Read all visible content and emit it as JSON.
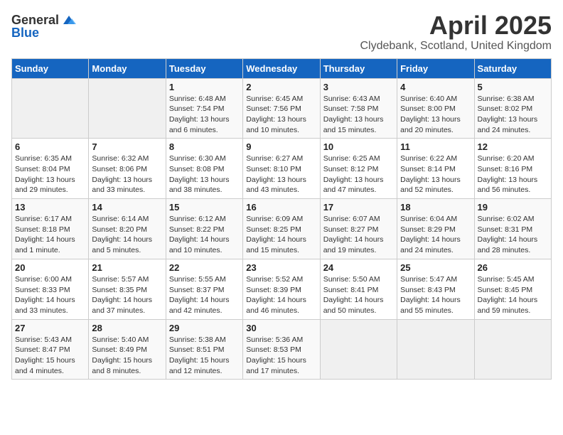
{
  "header": {
    "logo_general": "General",
    "logo_blue": "Blue",
    "month_year": "April 2025",
    "location": "Clydebank, Scotland, United Kingdom"
  },
  "weekdays": [
    "Sunday",
    "Monday",
    "Tuesday",
    "Wednesday",
    "Thursday",
    "Friday",
    "Saturday"
  ],
  "weeks": [
    [
      {
        "day": "",
        "info": ""
      },
      {
        "day": "",
        "info": ""
      },
      {
        "day": "1",
        "info": "Sunrise: 6:48 AM\nSunset: 7:54 PM\nDaylight: 13 hours\nand 6 minutes."
      },
      {
        "day": "2",
        "info": "Sunrise: 6:45 AM\nSunset: 7:56 PM\nDaylight: 13 hours\nand 10 minutes."
      },
      {
        "day": "3",
        "info": "Sunrise: 6:43 AM\nSunset: 7:58 PM\nDaylight: 13 hours\nand 15 minutes."
      },
      {
        "day": "4",
        "info": "Sunrise: 6:40 AM\nSunset: 8:00 PM\nDaylight: 13 hours\nand 20 minutes."
      },
      {
        "day": "5",
        "info": "Sunrise: 6:38 AM\nSunset: 8:02 PM\nDaylight: 13 hours\nand 24 minutes."
      }
    ],
    [
      {
        "day": "6",
        "info": "Sunrise: 6:35 AM\nSunset: 8:04 PM\nDaylight: 13 hours\nand 29 minutes."
      },
      {
        "day": "7",
        "info": "Sunrise: 6:32 AM\nSunset: 8:06 PM\nDaylight: 13 hours\nand 33 minutes."
      },
      {
        "day": "8",
        "info": "Sunrise: 6:30 AM\nSunset: 8:08 PM\nDaylight: 13 hours\nand 38 minutes."
      },
      {
        "day": "9",
        "info": "Sunrise: 6:27 AM\nSunset: 8:10 PM\nDaylight: 13 hours\nand 43 minutes."
      },
      {
        "day": "10",
        "info": "Sunrise: 6:25 AM\nSunset: 8:12 PM\nDaylight: 13 hours\nand 47 minutes."
      },
      {
        "day": "11",
        "info": "Sunrise: 6:22 AM\nSunset: 8:14 PM\nDaylight: 13 hours\nand 52 minutes."
      },
      {
        "day": "12",
        "info": "Sunrise: 6:20 AM\nSunset: 8:16 PM\nDaylight: 13 hours\nand 56 minutes."
      }
    ],
    [
      {
        "day": "13",
        "info": "Sunrise: 6:17 AM\nSunset: 8:18 PM\nDaylight: 14 hours\nand 1 minute."
      },
      {
        "day": "14",
        "info": "Sunrise: 6:14 AM\nSunset: 8:20 PM\nDaylight: 14 hours\nand 5 minutes."
      },
      {
        "day": "15",
        "info": "Sunrise: 6:12 AM\nSunset: 8:22 PM\nDaylight: 14 hours\nand 10 minutes."
      },
      {
        "day": "16",
        "info": "Sunrise: 6:09 AM\nSunset: 8:25 PM\nDaylight: 14 hours\nand 15 minutes."
      },
      {
        "day": "17",
        "info": "Sunrise: 6:07 AM\nSunset: 8:27 PM\nDaylight: 14 hours\nand 19 minutes."
      },
      {
        "day": "18",
        "info": "Sunrise: 6:04 AM\nSunset: 8:29 PM\nDaylight: 14 hours\nand 24 minutes."
      },
      {
        "day": "19",
        "info": "Sunrise: 6:02 AM\nSunset: 8:31 PM\nDaylight: 14 hours\nand 28 minutes."
      }
    ],
    [
      {
        "day": "20",
        "info": "Sunrise: 6:00 AM\nSunset: 8:33 PM\nDaylight: 14 hours\nand 33 minutes."
      },
      {
        "day": "21",
        "info": "Sunrise: 5:57 AM\nSunset: 8:35 PM\nDaylight: 14 hours\nand 37 minutes."
      },
      {
        "day": "22",
        "info": "Sunrise: 5:55 AM\nSunset: 8:37 PM\nDaylight: 14 hours\nand 42 minutes."
      },
      {
        "day": "23",
        "info": "Sunrise: 5:52 AM\nSunset: 8:39 PM\nDaylight: 14 hours\nand 46 minutes."
      },
      {
        "day": "24",
        "info": "Sunrise: 5:50 AM\nSunset: 8:41 PM\nDaylight: 14 hours\nand 50 minutes."
      },
      {
        "day": "25",
        "info": "Sunrise: 5:47 AM\nSunset: 8:43 PM\nDaylight: 14 hours\nand 55 minutes."
      },
      {
        "day": "26",
        "info": "Sunrise: 5:45 AM\nSunset: 8:45 PM\nDaylight: 14 hours\nand 59 minutes."
      }
    ],
    [
      {
        "day": "27",
        "info": "Sunrise: 5:43 AM\nSunset: 8:47 PM\nDaylight: 15 hours\nand 4 minutes."
      },
      {
        "day": "28",
        "info": "Sunrise: 5:40 AM\nSunset: 8:49 PM\nDaylight: 15 hours\nand 8 minutes."
      },
      {
        "day": "29",
        "info": "Sunrise: 5:38 AM\nSunset: 8:51 PM\nDaylight: 15 hours\nand 12 minutes."
      },
      {
        "day": "30",
        "info": "Sunrise: 5:36 AM\nSunset: 8:53 PM\nDaylight: 15 hours\nand 17 minutes."
      },
      {
        "day": "",
        "info": ""
      },
      {
        "day": "",
        "info": ""
      },
      {
        "day": "",
        "info": ""
      }
    ]
  ]
}
